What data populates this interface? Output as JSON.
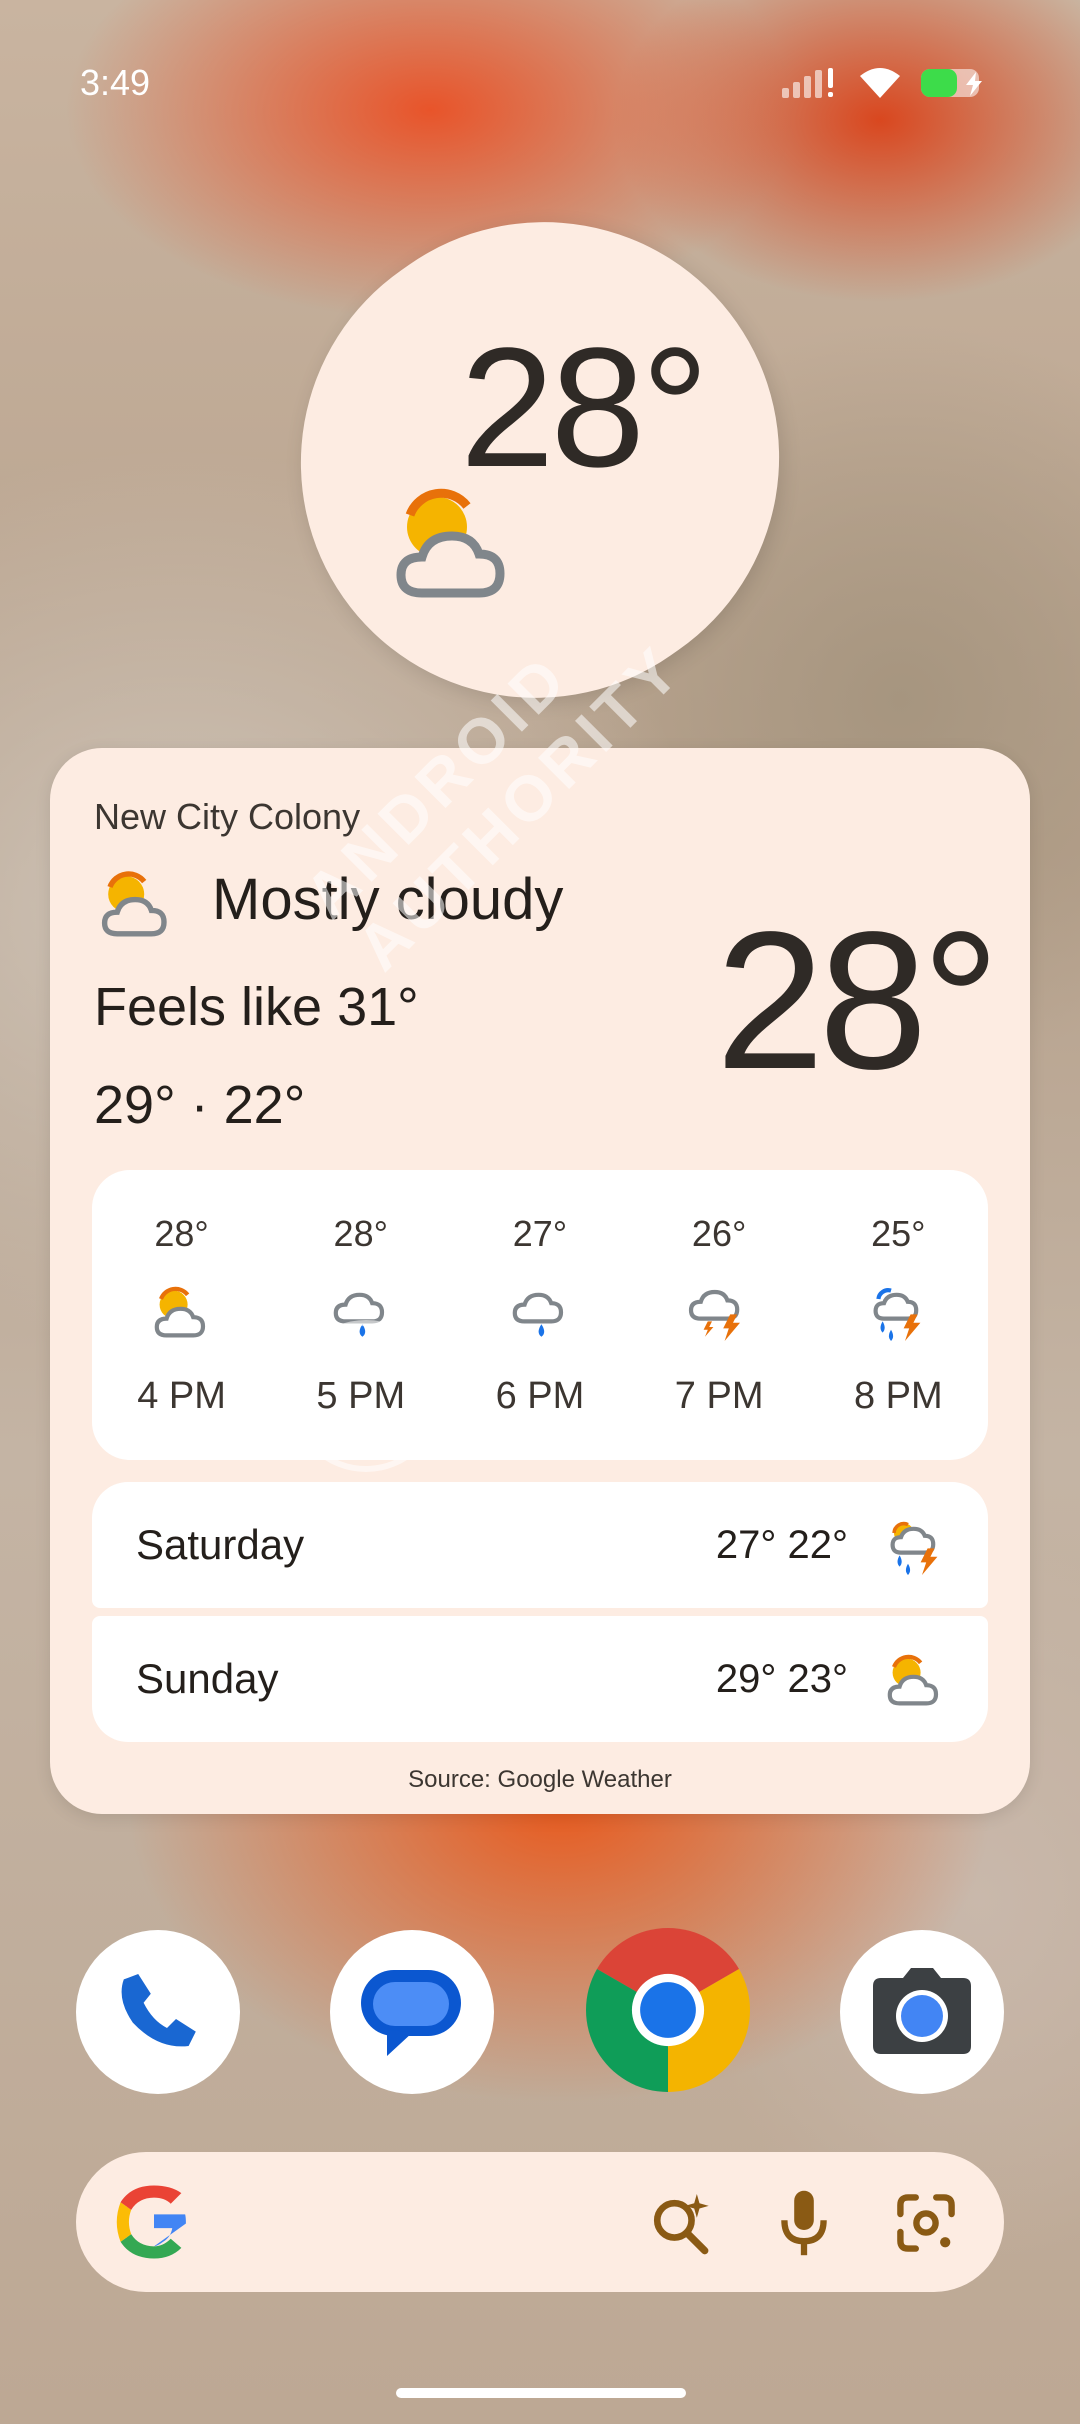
{
  "status_bar": {
    "time": "3:49"
  },
  "top_weather_widget": {
    "temperature": "28°",
    "icon": "partly-cloudy-icon"
  },
  "weather_card": {
    "location": "New City Colony",
    "condition": "Mostly cloudy",
    "condition_icon": "partly-cloudy-icon",
    "feels_like": "Feels like 31°",
    "hi_lo": "29° · 22°",
    "current_temp": "28°",
    "hourly": [
      {
        "temp": "28°",
        "time": "4 PM",
        "icon": "partly-cloudy-icon"
      },
      {
        "temp": "28°",
        "time": "5 PM",
        "icon": "rain-cloud-icon"
      },
      {
        "temp": "27°",
        "time": "6 PM",
        "icon": "rain-cloud-icon"
      },
      {
        "temp": "26°",
        "time": "7 PM",
        "icon": "thunderstorm-icon"
      },
      {
        "temp": "25°",
        "time": "8 PM",
        "icon": "rain-thunder-icon"
      }
    ],
    "daily": [
      {
        "day": "Saturday",
        "temps": "27° 22°",
        "icon": "rain-thunder-icon"
      },
      {
        "day": "Sunday",
        "temps": "29° 23°",
        "icon": "partly-cloudy-icon"
      }
    ],
    "source": "Source: Google Weather"
  },
  "watermark": {
    "text": "ANDROID AUTHORITY"
  },
  "dock": {
    "apps": [
      {
        "name": "Phone",
        "icon": "phone-icon"
      },
      {
        "name": "Messages",
        "icon": "messages-icon"
      },
      {
        "name": "Chrome",
        "icon": "chrome-icon"
      },
      {
        "name": "Camera",
        "icon": "camera-icon"
      }
    ]
  },
  "search_bar": {
    "icons": [
      "google-g-icon",
      "ai-search-icon",
      "mic-icon",
      "lens-icon"
    ]
  },
  "colors": {
    "card_bg": "#fdece2",
    "text_dark": "#241f1b",
    "sun": "#f5b400",
    "sun_edge": "#e8710a",
    "cloud_stroke": "#80868b",
    "rain": "#1a73e8",
    "bolt": "#e8710a"
  }
}
